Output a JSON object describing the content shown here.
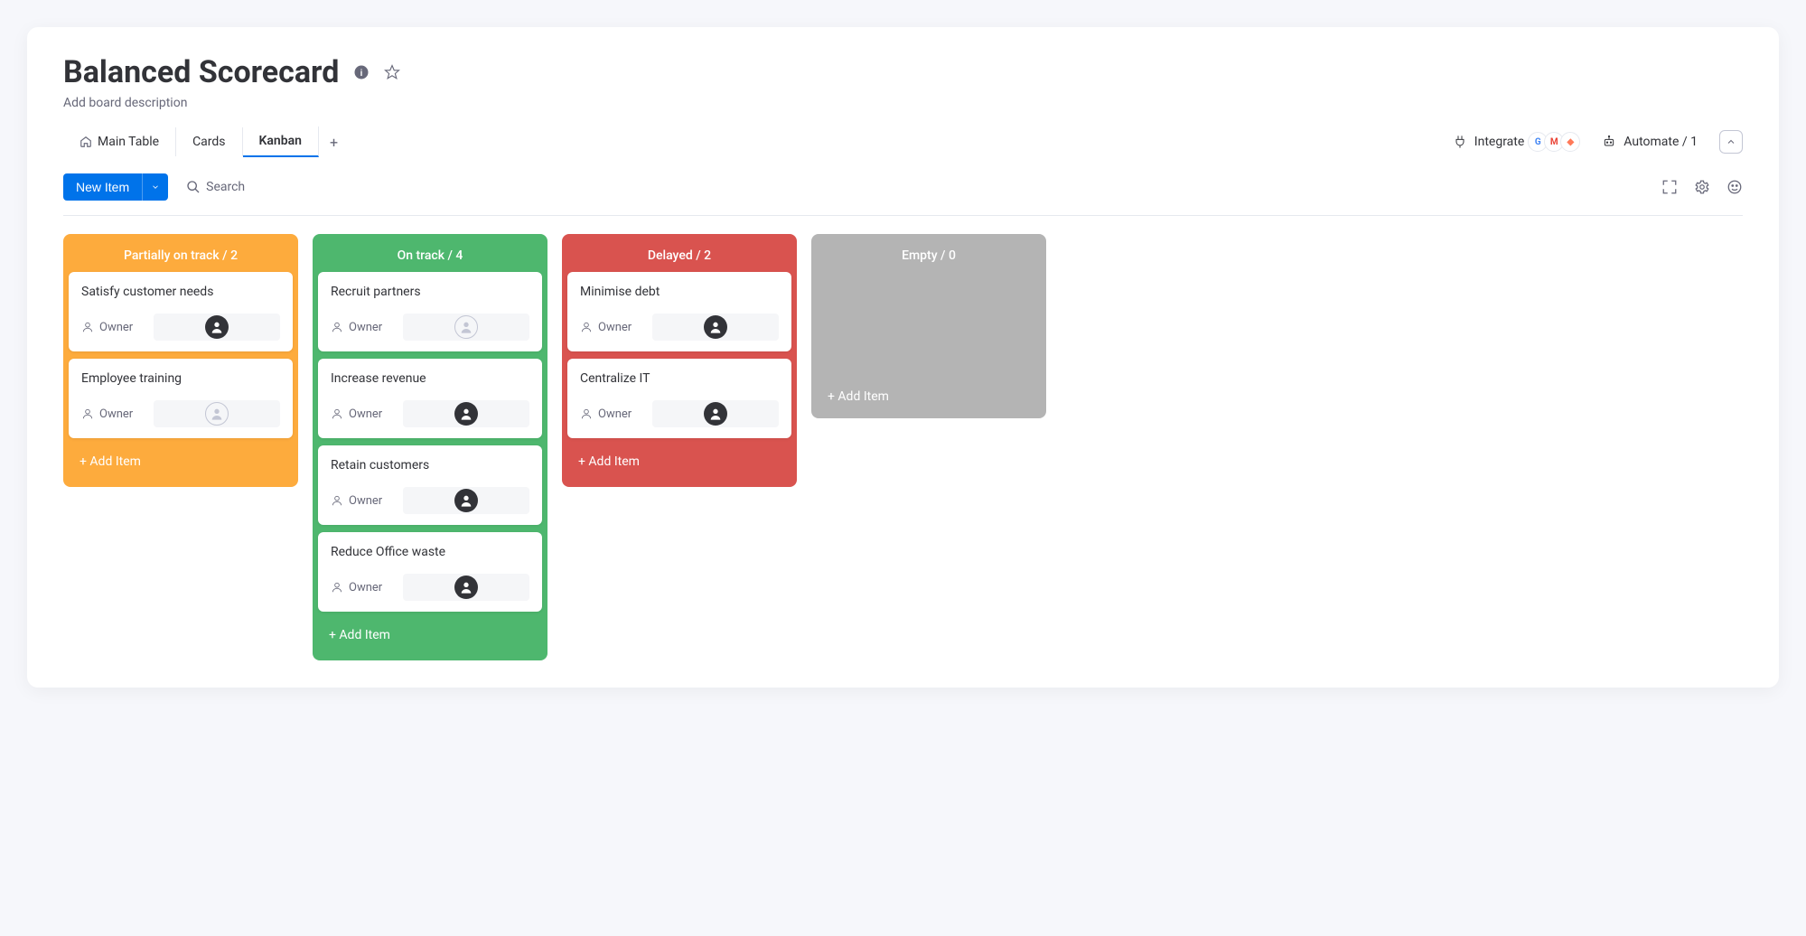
{
  "header": {
    "title": "Balanced Scorecard",
    "description": "Add board description"
  },
  "tabs": {
    "main_table": "Main Table",
    "cards": "Cards",
    "kanban": "Kanban"
  },
  "actions": {
    "integrate": "Integrate",
    "automate": "Automate / 1"
  },
  "toolbar": {
    "new_item": "New Item",
    "search": "Search"
  },
  "labels": {
    "owner": "Owner",
    "add_item": "+ Add Item"
  },
  "columns": [
    {
      "id": "partially",
      "title": "Partially on track / 2",
      "color": "col-orange",
      "cards": [
        {
          "title": "Satisfy customer needs",
          "owner_assigned": true
        },
        {
          "title": "Employee training",
          "owner_assigned": false
        }
      ]
    },
    {
      "id": "ontrack",
      "title": "On track / 4",
      "color": "col-green",
      "cards": [
        {
          "title": "Recruit partners",
          "owner_assigned": false
        },
        {
          "title": "Increase revenue",
          "owner_assigned": true
        },
        {
          "title": "Retain customers",
          "owner_assigned": true
        },
        {
          "title": "Reduce Office waste",
          "owner_assigned": true
        }
      ]
    },
    {
      "id": "delayed",
      "title": "Delayed / 2",
      "color": "col-red",
      "cards": [
        {
          "title": "Minimise debt",
          "owner_assigned": true
        },
        {
          "title": "Centralize IT",
          "owner_assigned": true
        }
      ]
    },
    {
      "id": "empty",
      "title": "Empty / 0",
      "color": "col-gray",
      "cards": []
    }
  ]
}
